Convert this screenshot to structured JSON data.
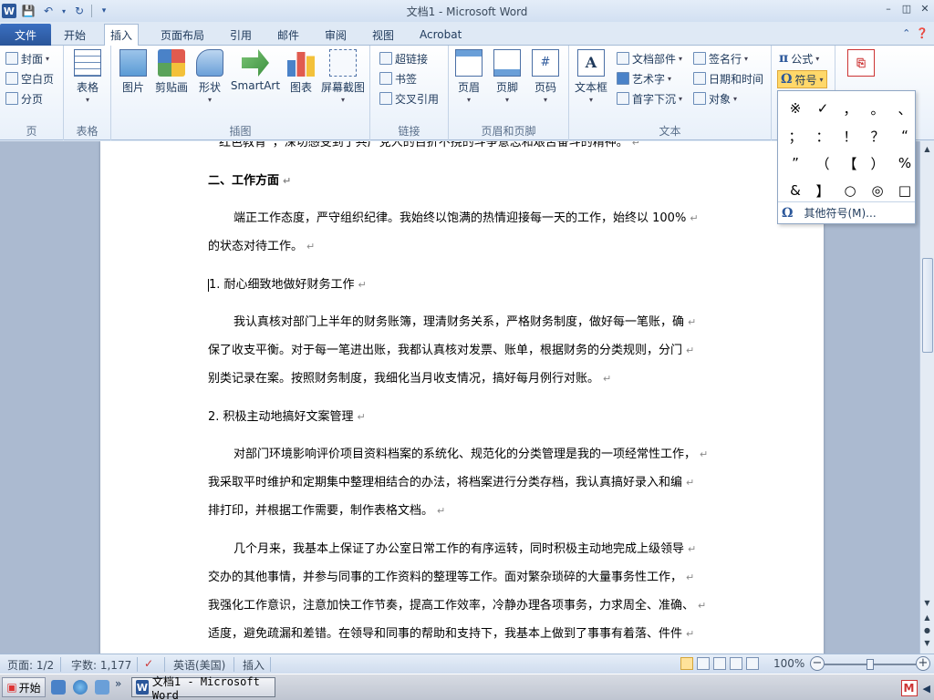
{
  "window": {
    "title": "文档1 - Microsoft Word",
    "app_icon": "W",
    "controls": [
      "–",
      "◫",
      "✕"
    ]
  },
  "tabs": {
    "file": "文件",
    "items": [
      "开始",
      "插入",
      "页面布局",
      "引用",
      "邮件",
      "审阅",
      "视图",
      "Acrobat"
    ],
    "active_index": 1
  },
  "ribbon": {
    "groups": {
      "pages": {
        "label": "页",
        "cover": "封面",
        "blank": "空白页",
        "break": "分页"
      },
      "tables": {
        "label": "表格",
        "table": "表格"
      },
      "illustrations": {
        "label": "插图",
        "picture": "图片",
        "clipart": "剪贴画",
        "shapes": "形状",
        "smartart": "SmartArt",
        "chart": "图表",
        "screenshot": "屏幕截图"
      },
      "links": {
        "label": "链接",
        "hyperlink": "超链接",
        "bookmark": "书签",
        "crossref": "交叉引用"
      },
      "header_footer": {
        "label": "页眉和页脚",
        "header": "页眉",
        "footer": "页脚",
        "page_number": "页码"
      },
      "text": {
        "label": "文本",
        "textbox": "文本框",
        "quickparts": "文档部件",
        "wordart": "艺术字",
        "dropcap": "首字下沉",
        "signature": "签名行",
        "datetime": "日期和时间",
        "object": "对象"
      },
      "symbols": {
        "equation": "公式",
        "symbol": "符号"
      }
    }
  },
  "symbol_dropdown": {
    "symbols": [
      "※",
      "✓",
      "，",
      "。",
      "、",
      "；",
      "：",
      "！",
      "？",
      "“",
      "”",
      "（",
      "【",
      "）",
      "%",
      "&",
      "】",
      "○",
      "◎",
      "□"
    ],
    "more": "其他符号(M)..."
  },
  "document": {
    "lines": [
      {
        "text": "红色教育”，深切感受到了共产党人的百折不挠的斗争意志和艰苦奋斗的精神。",
        "style": "cut"
      },
      {
        "text": "二、工作方面",
        "style": "bold"
      },
      {
        "text": "端正工作态度，严守组织纪律。我始终以饱满的热情迎接每一天的工作，始终以 100%",
        "style": "indent"
      },
      {
        "text": "的状态对待工作。",
        "style": "plain"
      },
      {
        "text": "1. 耐心细致地做好财务工作",
        "style": "cursor"
      },
      {
        "text": "我认真核对部门上半年的财务账簿，理清财务关系，严格财务制度，做好每一笔账，确",
        "style": "indent"
      },
      {
        "text": "保了收支平衡。对于每一笔进出账，我都认真核对发票、账单，根据财务的分类规则，分门",
        "style": "plain"
      },
      {
        "text": "别类记录在案。按照财务制度，我细化当月收支情况，搞好每月例行对账。",
        "style": "plain"
      },
      {
        "text": "2. 积极主动地搞好文案管理",
        "style": "plain"
      },
      {
        "text": "对部门环境影响评价项目资料档案的系统化、规范化的分类管理是我的一项经常性工作，",
        "style": "indent"
      },
      {
        "text": "我采取平时维护和定期集中整理相结合的办法，将档案进行分类存档，我认真搞好录入和编",
        "style": "plain"
      },
      {
        "text": "排打印，并根据工作需要，制作表格文档。",
        "style": "plain"
      },
      {
        "text": "几个月来，我基本上保证了办公室日常工作的有序运转，同时积极主动地完成上级领导",
        "style": "indent"
      },
      {
        "text": "交办的其他事情，并参与同事的工作资料的整理等工作。面对繁杂琐碎的大量事务性工作，",
        "style": "plain"
      },
      {
        "text": "我强化工作意识，注意加快工作节奏，提高工作效率，冷静办理各项事务，力求周全、准确、",
        "style": "plain"
      },
      {
        "text": "适度，避免疏漏和差错。在领导和同事的帮助和支持下，我基本上做到了事事有着落、件件",
        "style": "plain"
      }
    ]
  },
  "status": {
    "page": "页面: 1/2",
    "words": "字数: 1,177",
    "language": "英语(美国)",
    "mode": "插入",
    "zoom": "100%"
  },
  "taskbar": {
    "start": "开始",
    "task": "文档1 - Microsoft Word",
    "tray_icon": "M"
  }
}
